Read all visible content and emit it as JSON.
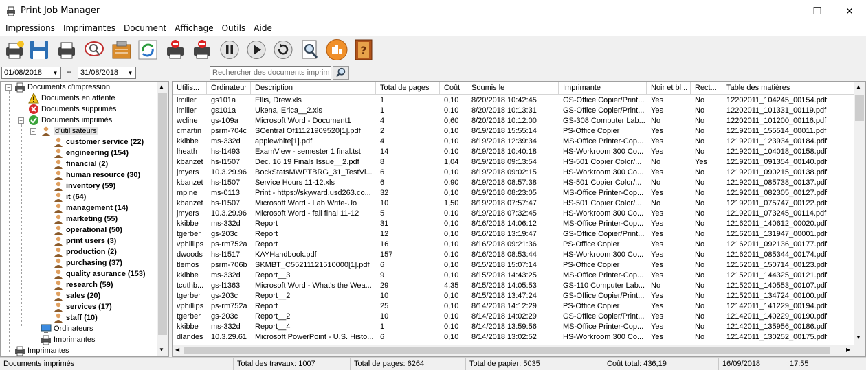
{
  "window": {
    "title": "Print Job Manager",
    "minimize": "—",
    "maximize": "☐",
    "close": "✕"
  },
  "menu": [
    "Impressions",
    "Imprimantes",
    "Document",
    "Affichage",
    "Outils",
    "Aide"
  ],
  "toolbar_icons": [
    "printer-star-icon",
    "save-icon",
    "printer-icon",
    "search-chat-icon",
    "clipboard-icon",
    "refresh-icon",
    "printer-delete-icon",
    "printer-delete-all-icon",
    "pause-icon",
    "play-icon",
    "restart-icon",
    "print-preview-icon",
    "reports-icon",
    "help-book-icon"
  ],
  "filter": {
    "date_from": "01/08/2018",
    "separator": "--",
    "date_to": "31/08/2018",
    "search_placeholder": "Rechercher des documents imprimés"
  },
  "tree": {
    "root": "Documents  d'impression",
    "pending": "Documents en attente",
    "deleted": "Documents supprimés",
    "printed": "Documents imprimés",
    "users_node": "d'utilisateurs",
    "groups": [
      "customer service (22)",
      "engineering (154)",
      "financial (2)",
      "human resource (30)",
      "inventory (59)",
      "it (64)",
      "management (14)",
      "marketing (55)",
      "operational (50)",
      "print users (3)",
      "production (2)",
      "purchasing (37)",
      "quality asurance (153)",
      "research (59)",
      "sales (20)",
      "services (17)",
      "staff (10)"
    ],
    "computers": "Ordinateurs",
    "printers_sub": "Imprimantes",
    "printers_root": "Imprimantes"
  },
  "grid": {
    "columns": [
      "Utilis...",
      "Ordinateur",
      "Description",
      "Total de pages",
      "Coût",
      "Soumis le",
      "Imprimante",
      "Noir et bl...",
      "Rect...",
      "Table des matières"
    ],
    "rows": [
      [
        "lmiller",
        "gs101a",
        "Ellis, Drew.xls",
        "1",
        "0,10",
        "8/20/2018 10:42:45",
        "GS-Office Copier/Print...",
        "Yes",
        "No",
        "12202011_104245_00154.pdf"
      ],
      [
        "lmiller",
        "gs101a",
        "Ukena, Erica__2.xls",
        "1",
        "0,10",
        "8/20/2018 10:13:31",
        "GS-Office Copier/Print...",
        "Yes",
        "No",
        "12202011_101331_00119.pdf"
      ],
      [
        "wcline",
        "gs-109a",
        "Microsoft Word - Document1",
        "4",
        "0,60",
        "8/20/2018 10:12:00",
        "GS-308 Computer Lab...",
        "No",
        "No",
        "12202011_101200_00116.pdf"
      ],
      [
        "cmartin",
        "psrm-704c",
        "SCentral Of11121909520[1].pdf",
        "2",
        "0,10",
        "8/19/2018 15:55:14",
        "PS-Office Copier",
        "Yes",
        "No",
        "12192011_155514_00011.pdf"
      ],
      [
        "kkibbe",
        "ms-332d",
        "applewhite[1].pdf",
        "4",
        "0,10",
        "8/19/2018 12:39:34",
        "MS-Office Printer-Cop...",
        "Yes",
        "No",
        "12192011_123934_00184.pdf"
      ],
      [
        "lheath",
        "hs-l1493",
        "ExamView - semester 1 final.tst",
        "14",
        "0,10",
        "8/19/2018 10:40:18",
        "HS-Workroom 300 Co...",
        "Yes",
        "No",
        "12192011_104018_00158.pdf"
      ],
      [
        "kbanzet",
        "hs-l1507",
        "Dec. 16  19 Finals Issue__2.pdf",
        "8",
        "1,04",
        "8/19/2018 09:13:54",
        "HS-501 Copier Color/...",
        "No",
        "Yes",
        "12192011_091354_00140.pdf"
      ],
      [
        "jmyers",
        "10.3.29.96",
        "BockStatsMWPTBRG_31_TestVl...",
        "6",
        "0,10",
        "8/19/2018 09:02:15",
        "HS-Workroom 300 Co...",
        "Yes",
        "No",
        "12192011_090215_00138.pdf"
      ],
      [
        "kbanzet",
        "hs-l1507",
        "Service Hours 11-12.xls",
        "6",
        "0,90",
        "8/19/2018 08:57:38",
        "HS-501 Copier Color/...",
        "No",
        "No",
        "12192011_085738_00137.pdf"
      ],
      [
        "mpine",
        "ms-0113",
        "Print - https://skyward.usd263.co...",
        "32",
        "0,10",
        "8/19/2018 08:23:05",
        "MS-Office Printer-Cop...",
        "Yes",
        "No",
        "12192011_082305_00127.pdf"
      ],
      [
        "kbanzet",
        "hs-l1507",
        "Microsoft Word - Lab Write-Uo",
        "10",
        "1,50",
        "8/19/2018 07:57:47",
        "HS-501 Copier Color/...",
        "No",
        "No",
        "12192011_075747_00122.pdf"
      ],
      [
        "jmyers",
        "10.3.29.96",
        "Microsoft Word - fall final 11-12",
        "5",
        "0,10",
        "8/19/2018 07:32:45",
        "HS-Workroom 300 Co...",
        "Yes",
        "No",
        "12192011_073245_00114.pdf"
      ],
      [
        "kkibbe",
        "ms-332d",
        "Report",
        "31",
        "0,10",
        "8/16/2018 14:06:12",
        "MS-Office Printer-Cop...",
        "Yes",
        "No",
        "12162011_140612_00020.pdf"
      ],
      [
        "tgerber",
        "gs-203c",
        "Report",
        "12",
        "0,10",
        "8/16/2018 13:19:47",
        "GS-Office Copier/Print...",
        "Yes",
        "No",
        "12162011_131947_00001.pdf"
      ],
      [
        "vphillips",
        "ps-rm752a",
        "Report",
        "16",
        "0,10",
        "8/16/2018 09:21:36",
        "PS-Office Copier",
        "Yes",
        "No",
        "12162011_092136_00177.pdf"
      ],
      [
        "dwoods",
        "hs-l1517",
        "KAYHandbook.pdf",
        "157",
        "0,10",
        "8/16/2018 08:53:44",
        "HS-Workroom 300 Co...",
        "Yes",
        "No",
        "12162011_085344_00174.pdf"
      ],
      [
        "tlemos",
        "psrm-706b",
        "SKMBT_C55211121510000[1].pdf",
        "6",
        "0,10",
        "8/15/2018 15:07:14",
        "PS-Office Copier",
        "Yes",
        "No",
        "12152011_150714_00123.pdf"
      ],
      [
        "kkibbe",
        "ms-332d",
        "Report__3",
        "9",
        "0,10",
        "8/15/2018 14:43:25",
        "MS-Office Printer-Cop...",
        "Yes",
        "No",
        "12152011_144325_00121.pdf"
      ],
      [
        "tcuthb...",
        "gs-l1363",
        "Microsoft Word - What's the Wea...",
        "29",
        "4,35",
        "8/15/2018 14:05:53",
        "GS-110 Computer Lab...",
        "No",
        "No",
        "12152011_140553_00107.pdf"
      ],
      [
        "tgerber",
        "gs-203c",
        "Report__2",
        "10",
        "0,10",
        "8/15/2018 13:47:24",
        "GS-Office Copier/Print...",
        "Yes",
        "No",
        "12152011_134724_00100.pdf"
      ],
      [
        "vphillips",
        "ps-rm752a",
        "Report",
        "25",
        "0,10",
        "8/14/2018 14:12:29",
        "PS-Office Copier",
        "Yes",
        "No",
        "12142011_141229_00194.pdf"
      ],
      [
        "tgerber",
        "gs-203c",
        "Report__2",
        "10",
        "0,10",
        "8/14/2018 14:02:29",
        "GS-Office Copier/Print...",
        "Yes",
        "No",
        "12142011_140229_00190.pdf"
      ],
      [
        "kkibbe",
        "ms-332d",
        "Report__4",
        "1",
        "0,10",
        "8/14/2018 13:59:56",
        "MS-Office Printer-Cop...",
        "Yes",
        "No",
        "12142011_135956_00186.pdf"
      ],
      [
        "dlandes",
        "10.3.29.61",
        "Microsoft PowerPoint - U.S. Histo...",
        "6",
        "0,10",
        "8/14/2018 13:02:52",
        "HS-Workroom 300 Co...",
        "Yes",
        "No",
        "12142011_130252_00175.pdf"
      ]
    ]
  },
  "status": {
    "section": "Documents imprimés",
    "total_jobs": "Total des travaux: 1007",
    "total_pages": "Total de pages: 6264",
    "total_paper": "Total de papier: 5035",
    "total_cost": "Coût total: 436,19",
    "date": "16/09/2018",
    "time": "17:55"
  }
}
